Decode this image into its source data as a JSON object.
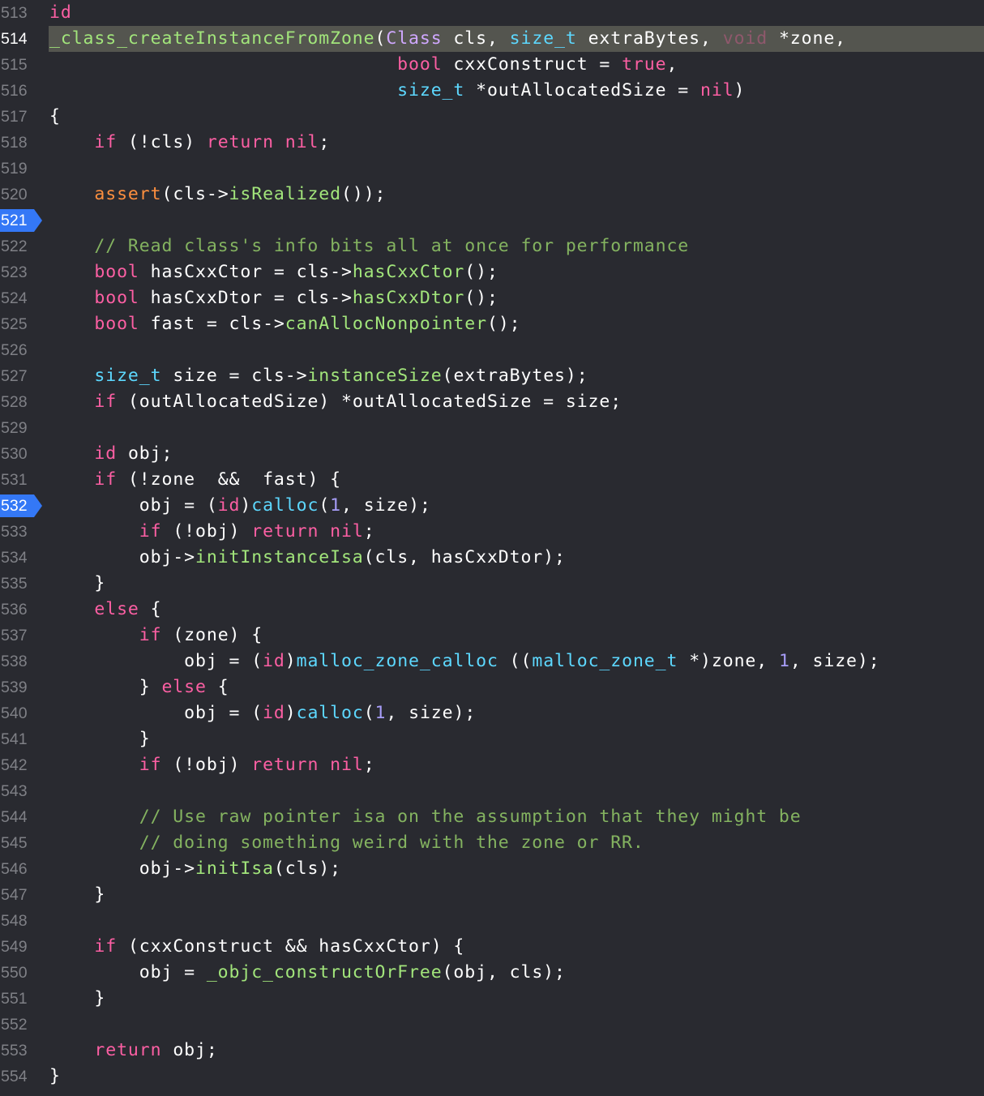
{
  "editor": {
    "language": "Objective-C++",
    "current_line": "514",
    "breakpoint_lines": [
      "521",
      "532"
    ],
    "colors": {
      "background": "#292a30",
      "keyword": "#fc5fa3",
      "type": "#5dd8ff",
      "function": "#67b7a4",
      "comment": "#84b360",
      "number": "#a79df8",
      "breakpoint": "#3478f6",
      "current_line_highlight": "#54554f"
    },
    "lines": [
      {
        "n": "513",
        "segs": [
          [
            "kw",
            "id"
          ]
        ]
      },
      {
        "n": "514",
        "segs": [
          [
            "pfn",
            "_class_createInstanceFromZone"
          ],
          [
            "plain",
            "("
          ],
          [
            "cls",
            "Class"
          ],
          [
            "plain",
            " cls, "
          ],
          [
            "ty",
            "size_t"
          ],
          [
            "plain",
            " extraBytes, "
          ],
          [
            "kwd",
            "void"
          ],
          [
            "plain",
            " *zone,"
          ]
        ]
      },
      {
        "n": "515",
        "segs": [
          [
            "plain",
            "                               "
          ],
          [
            "kw",
            "bool"
          ],
          [
            "plain",
            " cxxConstruct = "
          ],
          [
            "kw",
            "true"
          ],
          [
            "plain",
            ","
          ]
        ]
      },
      {
        "n": "516",
        "segs": [
          [
            "plain",
            "                               "
          ],
          [
            "ty",
            "size_t"
          ],
          [
            "plain",
            " *outAllocatedSize = "
          ],
          [
            "kw",
            "nil"
          ],
          [
            "plain",
            ")"
          ]
        ]
      },
      {
        "n": "517",
        "segs": [
          [
            "plain",
            "{"
          ]
        ]
      },
      {
        "n": "518",
        "segs": [
          [
            "plain",
            "    "
          ],
          [
            "kw",
            "if"
          ],
          [
            "plain",
            " (!cls) "
          ],
          [
            "kw",
            "return"
          ],
          [
            "plain",
            " "
          ],
          [
            "kw",
            "nil"
          ],
          [
            "plain",
            ";"
          ]
        ]
      },
      {
        "n": "519",
        "segs": []
      },
      {
        "n": "520",
        "segs": [
          [
            "plain",
            "    "
          ],
          [
            "mac",
            "assert"
          ],
          [
            "plain",
            "(cls->"
          ],
          [
            "pfn",
            "isRealized"
          ],
          [
            "plain",
            "());"
          ]
        ]
      },
      {
        "n": "521",
        "segs": []
      },
      {
        "n": "522",
        "segs": [
          [
            "plain",
            "    "
          ],
          [
            "cmg",
            "// Read class's info bits all at once for performance"
          ]
        ]
      },
      {
        "n": "523",
        "segs": [
          [
            "plain",
            "    "
          ],
          [
            "kw",
            "bool"
          ],
          [
            "plain",
            " hasCxxCtor = cls->"
          ],
          [
            "pfn",
            "hasCxxCtor"
          ],
          [
            "plain",
            "();"
          ]
        ]
      },
      {
        "n": "524",
        "segs": [
          [
            "plain",
            "    "
          ],
          [
            "kw",
            "bool"
          ],
          [
            "plain",
            " hasCxxDtor = cls->"
          ],
          [
            "pfn",
            "hasCxxDtor"
          ],
          [
            "plain",
            "();"
          ]
        ]
      },
      {
        "n": "525",
        "segs": [
          [
            "plain",
            "    "
          ],
          [
            "kw",
            "bool"
          ],
          [
            "plain",
            " fast = cls->"
          ],
          [
            "pfn",
            "canAllocNonpointer"
          ],
          [
            "plain",
            "();"
          ]
        ]
      },
      {
        "n": "526",
        "segs": []
      },
      {
        "n": "527",
        "segs": [
          [
            "plain",
            "    "
          ],
          [
            "ty",
            "size_t"
          ],
          [
            "plain",
            " size = cls->"
          ],
          [
            "pfn",
            "instanceSize"
          ],
          [
            "plain",
            "(extraBytes);"
          ]
        ]
      },
      {
        "n": "528",
        "segs": [
          [
            "plain",
            "    "
          ],
          [
            "kw",
            "if"
          ],
          [
            "plain",
            " (outAllocatedSize) *outAllocatedSize = size;"
          ]
        ]
      },
      {
        "n": "529",
        "segs": []
      },
      {
        "n": "530",
        "segs": [
          [
            "plain",
            "    "
          ],
          [
            "kw",
            "id"
          ],
          [
            "plain",
            " obj;"
          ]
        ]
      },
      {
        "n": "531",
        "segs": [
          [
            "plain",
            "    "
          ],
          [
            "kw",
            "if"
          ],
          [
            "plain",
            " (!zone  &&  fast) {"
          ]
        ]
      },
      {
        "n": "532",
        "segs": [
          [
            "plain",
            "        obj = ("
          ],
          [
            "kw",
            "id"
          ],
          [
            "plain",
            ")"
          ],
          [
            "ty",
            "calloc"
          ],
          [
            "plain",
            "("
          ],
          [
            "num2",
            "1"
          ],
          [
            "plain",
            ", size);"
          ]
        ]
      },
      {
        "n": "533",
        "segs": [
          [
            "plain",
            "        "
          ],
          [
            "kw",
            "if"
          ],
          [
            "plain",
            " (!obj) "
          ],
          [
            "kw",
            "return"
          ],
          [
            "plain",
            " "
          ],
          [
            "kw",
            "nil"
          ],
          [
            "plain",
            ";"
          ]
        ]
      },
      {
        "n": "534",
        "segs": [
          [
            "plain",
            "        obj->"
          ],
          [
            "pfn",
            "initInstanceIsa"
          ],
          [
            "plain",
            "(cls, hasCxxDtor);"
          ]
        ]
      },
      {
        "n": "535",
        "segs": [
          [
            "plain",
            "    }"
          ]
        ]
      },
      {
        "n": "536",
        "segs": [
          [
            "plain",
            "    "
          ],
          [
            "kw",
            "else"
          ],
          [
            "plain",
            " {"
          ]
        ]
      },
      {
        "n": "537",
        "segs": [
          [
            "plain",
            "        "
          ],
          [
            "kw",
            "if"
          ],
          [
            "plain",
            " (zone) {"
          ]
        ]
      },
      {
        "n": "538",
        "segs": [
          [
            "plain",
            "            obj = ("
          ],
          [
            "kw",
            "id"
          ],
          [
            "plain",
            ")"
          ],
          [
            "ty",
            "malloc_zone_calloc"
          ],
          [
            "plain",
            " (("
          ],
          [
            "ty",
            "malloc_zone_t"
          ],
          [
            "plain",
            " *)zone, "
          ],
          [
            "num2",
            "1"
          ],
          [
            "plain",
            ", size);"
          ]
        ]
      },
      {
        "n": "539",
        "segs": [
          [
            "plain",
            "        } "
          ],
          [
            "kw",
            "else"
          ],
          [
            "plain",
            " {"
          ]
        ]
      },
      {
        "n": "540",
        "segs": [
          [
            "plain",
            "            obj = ("
          ],
          [
            "kw",
            "id"
          ],
          [
            "plain",
            ")"
          ],
          [
            "ty",
            "calloc"
          ],
          [
            "plain",
            "("
          ],
          [
            "num2",
            "1"
          ],
          [
            "plain",
            ", size);"
          ]
        ]
      },
      {
        "n": "541",
        "segs": [
          [
            "plain",
            "        }"
          ]
        ]
      },
      {
        "n": "542",
        "segs": [
          [
            "plain",
            "        "
          ],
          [
            "kw",
            "if"
          ],
          [
            "plain",
            " (!obj) "
          ],
          [
            "kw",
            "return"
          ],
          [
            "plain",
            " "
          ],
          [
            "kw",
            "nil"
          ],
          [
            "plain",
            ";"
          ]
        ]
      },
      {
        "n": "543",
        "segs": []
      },
      {
        "n": "544",
        "segs": [
          [
            "plain",
            "        "
          ],
          [
            "cmg",
            "// Use raw pointer isa on the assumption that they might be"
          ]
        ]
      },
      {
        "n": "545",
        "segs": [
          [
            "plain",
            "        "
          ],
          [
            "cmg",
            "// doing something weird with the zone or RR."
          ]
        ]
      },
      {
        "n": "546",
        "segs": [
          [
            "plain",
            "        obj->"
          ],
          [
            "pfn",
            "initIsa"
          ],
          [
            "plain",
            "(cls);"
          ]
        ]
      },
      {
        "n": "547",
        "segs": [
          [
            "plain",
            "    }"
          ]
        ]
      },
      {
        "n": "548",
        "segs": []
      },
      {
        "n": "549",
        "segs": [
          [
            "plain",
            "    "
          ],
          [
            "kw",
            "if"
          ],
          [
            "plain",
            " (cxxConstruct && hasCxxCtor) {"
          ]
        ]
      },
      {
        "n": "550",
        "segs": [
          [
            "plain",
            "        obj = "
          ],
          [
            "pfn",
            "_objc_constructOrFree"
          ],
          [
            "plain",
            "(obj, cls);"
          ]
        ]
      },
      {
        "n": "551",
        "segs": [
          [
            "plain",
            "    }"
          ]
        ]
      },
      {
        "n": "552",
        "segs": []
      },
      {
        "n": "553",
        "segs": [
          [
            "plain",
            "    "
          ],
          [
            "kw",
            "return"
          ],
          [
            "plain",
            " obj;"
          ]
        ]
      },
      {
        "n": "554",
        "segs": [
          [
            "plain",
            "}"
          ]
        ]
      }
    ]
  }
}
